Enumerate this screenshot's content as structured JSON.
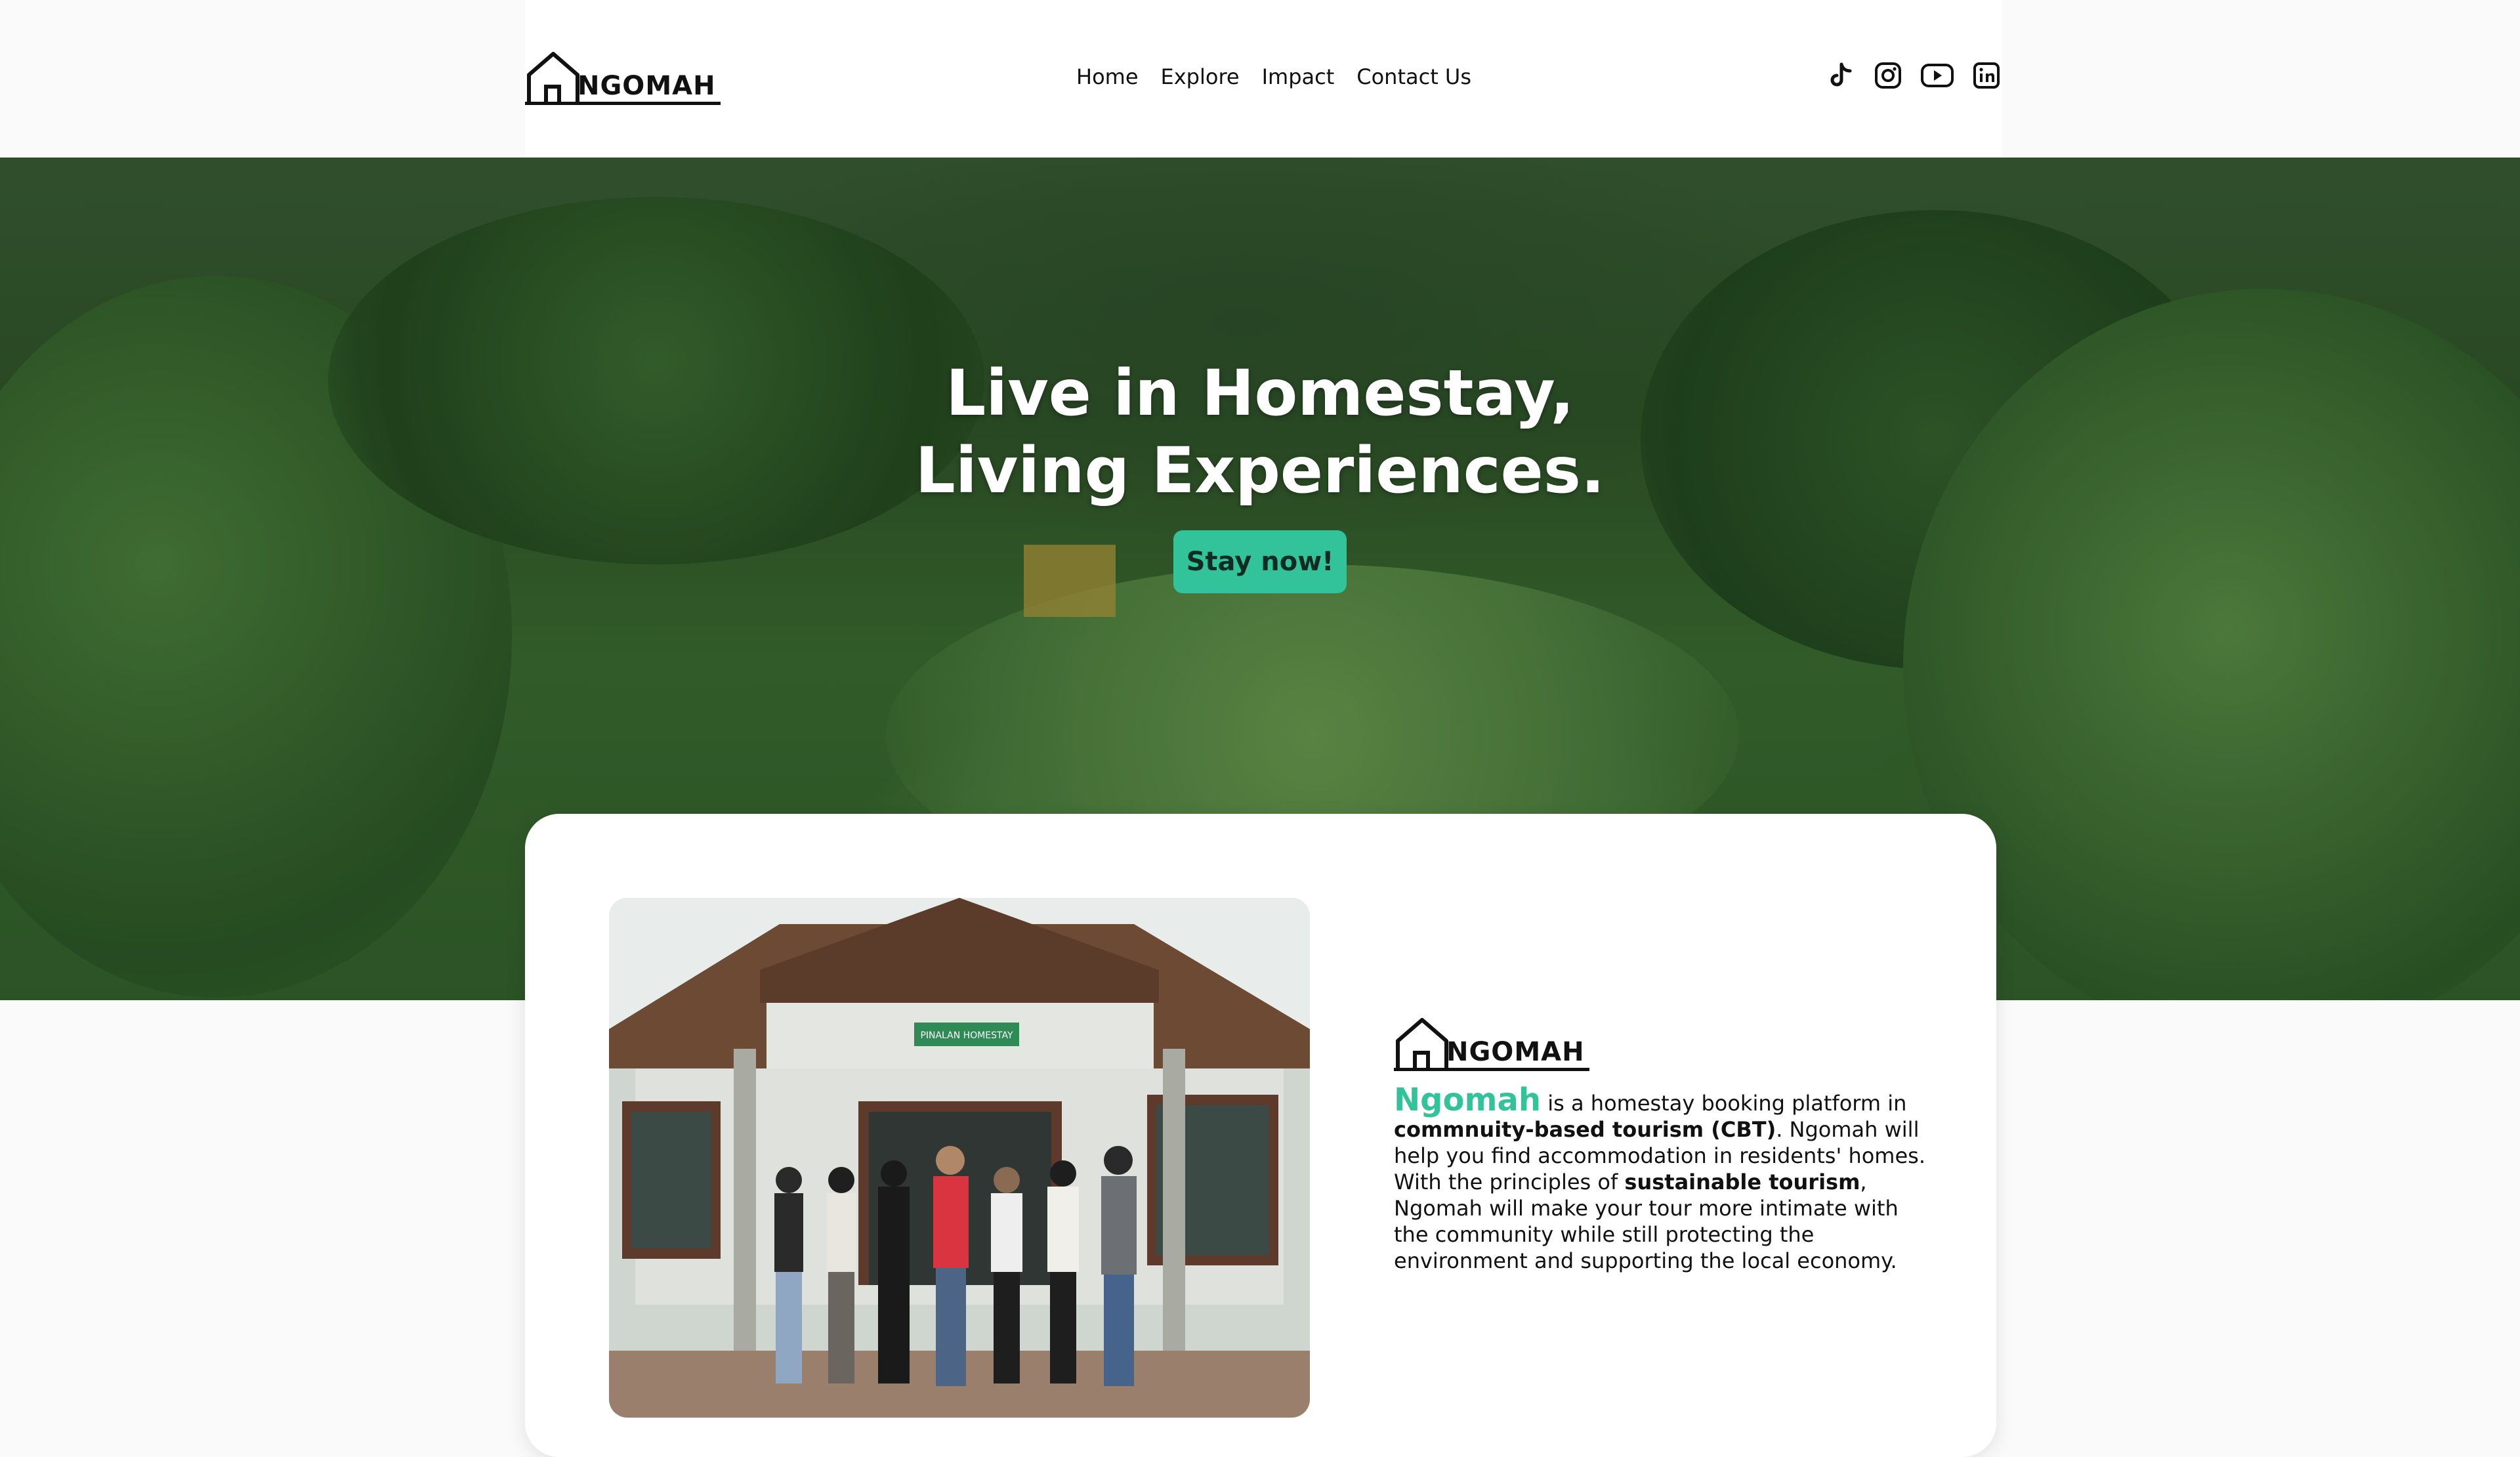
{
  "header": {
    "logo_text": "NGOMAH",
    "nav": [
      "Home",
      "Explore",
      "Impact",
      "Contact Us"
    ],
    "social_icons": [
      "tiktok-icon",
      "instagram-icon",
      "youtube-icon",
      "linkedin-icon"
    ]
  },
  "hero": {
    "title_line1": "Live in Homestay,",
    "title_line2": "Living Experiences.",
    "cta_label": "Stay now!"
  },
  "about": {
    "logo_text": "NGOMAH",
    "brand": "Ngomah",
    "text_1": " is a homestay booking platform in ",
    "bold_1": "commnuity-based tourism (CBT)",
    "text_2": ". Ngomah will help you find accommodation in residents' homes. With the principles of ",
    "bold_2": "sustainable tourism",
    "text_3": ", Ngomah will make your tour more intimate with the community while still protecting the environment and supporting the local economy.",
    "sign_text": "PINALAN HOMESTAY"
  },
  "colors": {
    "accent": "#33c39b",
    "text": "#111111",
    "background": "#fafafa"
  }
}
